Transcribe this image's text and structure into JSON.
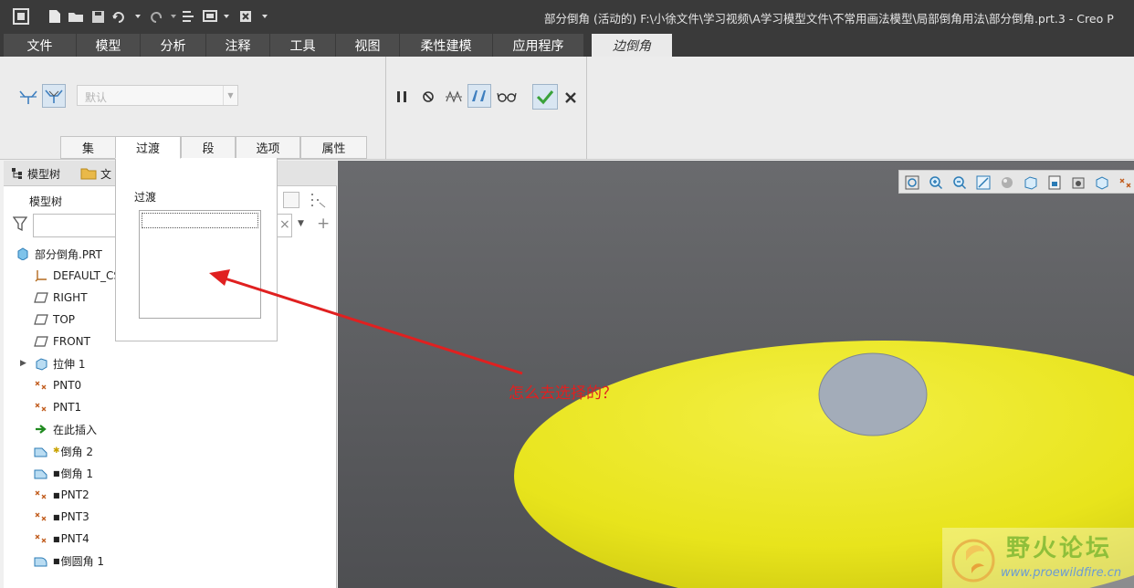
{
  "window": {
    "title": "部分倒角 (活动的) F:\\小徐文件\\学习视频\\A学习模型文件\\不常用画法模型\\局部倒角用法\\部分倒角.prt.3 - Creo P"
  },
  "menu_tabs": [
    "文件",
    "模型",
    "分析",
    "注释",
    "工具",
    "视图",
    "柔性建模",
    "应用程序",
    "边倒角"
  ],
  "ribbon": {
    "combo_value": "默认",
    "sub_tabs": [
      "集",
      "过渡",
      "段",
      "选项",
      "属性"
    ]
  },
  "transition_panel": {
    "label": "过渡"
  },
  "left_panel": {
    "tabs": [
      "模型树",
      "文"
    ],
    "tree_title": "模型树",
    "filter_value": "",
    "tree_items": [
      {
        "label": "部分倒角.PRT",
        "icon": "part-icon"
      },
      {
        "label": "DEFAULT_CS",
        "icon": "coordinate-system-icon"
      },
      {
        "label": "RIGHT",
        "icon": "datum-plane-icon"
      },
      {
        "label": "TOP",
        "icon": "datum-plane-icon"
      },
      {
        "label": "FRONT",
        "icon": "datum-plane-icon"
      },
      {
        "label": "拉伸 1",
        "icon": "extrude-icon"
      },
      {
        "label": "PNT0",
        "icon": "datum-point-icon"
      },
      {
        "label": "PNT1",
        "icon": "datum-point-icon"
      },
      {
        "label": "在此插入",
        "icon": "insert-here-arrow-icon"
      },
      {
        "label": "倒角 2",
        "icon": "chamfer-icon"
      },
      {
        "label": "倒角 1",
        "icon": "chamfer-icon"
      },
      {
        "label": "PNT2",
        "icon": "datum-point-icon"
      },
      {
        "label": "PNT3",
        "icon": "datum-point-icon"
      },
      {
        "label": "PNT4",
        "icon": "datum-point-icon"
      },
      {
        "label": "倒圆角 1",
        "icon": "round-icon"
      }
    ]
  },
  "annotation": {
    "text": "怎么去选择的？",
    "color": "#e02020"
  },
  "watermark": {
    "title": "野火论坛",
    "url": "www.proewildfire.cn"
  },
  "colors": {
    "model_yellow": "#e8e41c",
    "model_gray": "#a8b0bc",
    "viewport_bg": "#5a5b5e"
  }
}
